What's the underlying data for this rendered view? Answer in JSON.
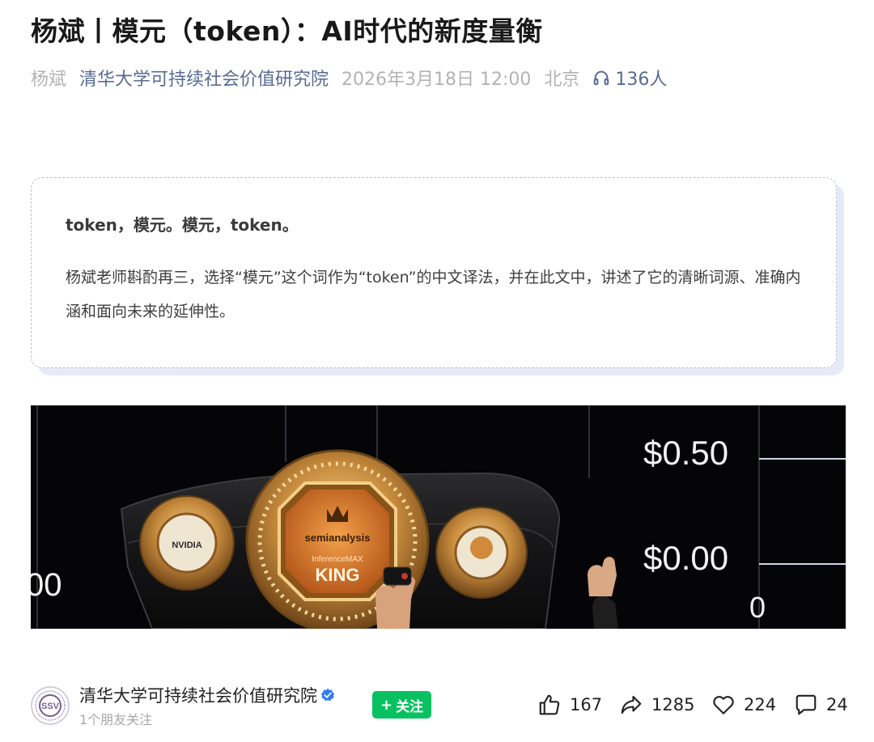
{
  "article": {
    "title": "杨斌丨模元（token）：AI时代的新度量衡",
    "author": "杨斌",
    "account": "清华大学可持续社会价值研究院",
    "publish_time": "2026年3月18日 12:00",
    "location": "北京",
    "listen_count": "136人"
  },
  "summary": {
    "heading": "token，模元。模元，token。",
    "body": "杨斌老师斟酌再三，选择“模元”这个词作为“token”的中文译法，并在此文中，讲述了它的清晰词源、准确内涵和面向未来的延伸性。"
  },
  "hero_image": {
    "price_high": "$0.50",
    "price_low": "$0.00",
    "edge_left": "00",
    "edge_right": "0",
    "plate_brand": "semianalysis",
    "plate_sub": "InferenceMAX",
    "plate_title": "KING",
    "left_medal": "NVIDIA"
  },
  "footer": {
    "avatar_text": "SSV",
    "account_name": "清华大学可持续社会价值研究院",
    "friends_following": "1个朋友关注",
    "follow_label": "关注",
    "likes": "167",
    "shares": "1285",
    "favorites": "224",
    "comments": "24"
  },
  "colors": {
    "link": "#576b95",
    "follow_green": "#07c160",
    "verified_blue": "#2f7cf6"
  }
}
